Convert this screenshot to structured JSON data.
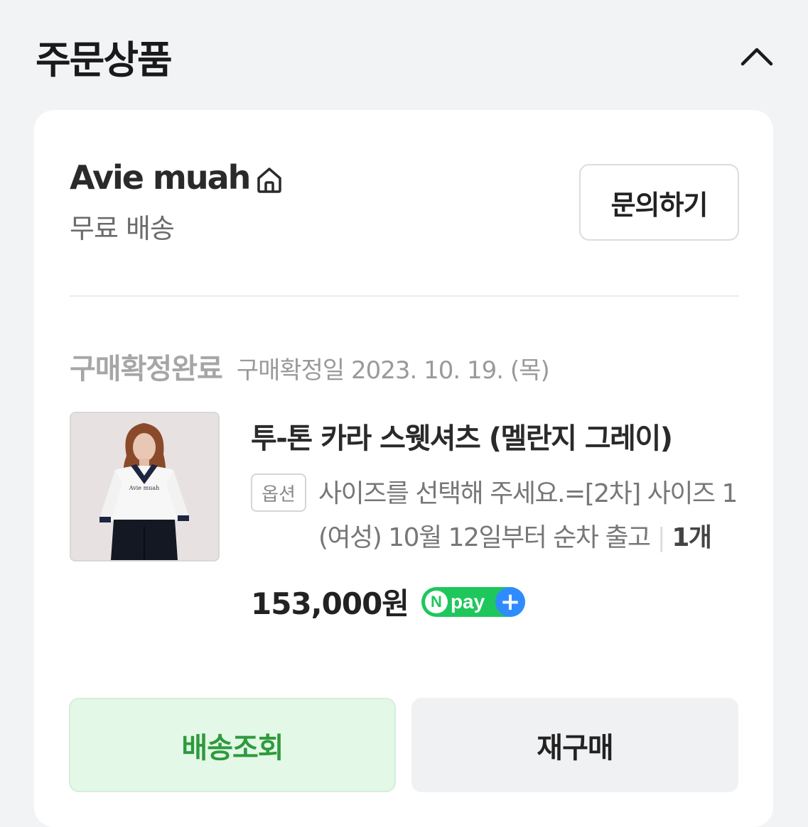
{
  "header": {
    "title": "주문상품",
    "collapse_icon": "chevron-up-icon"
  },
  "seller": {
    "name": "Avie muah",
    "home_icon": "home-icon",
    "shipping": "무료 배송",
    "inquiry_label": "문의하기"
  },
  "order": {
    "status": "구매확정완료",
    "confirm_date": "구매확정일 2023. 10. 19. (목)"
  },
  "product": {
    "name": "투-톤 카라 스웻셔츠 (멜란지 그레이)",
    "option_badge": "옵션",
    "option_text": "사이즈를 선택해 주세요.=[2차] 사이즈 1 (여성) 10월 12일부터 순차 출고",
    "quantity": "1개",
    "price": "153,000원",
    "thumbnail_caption": "Avie muah"
  },
  "npay": {
    "badge_n": "N",
    "badge_text": "pay",
    "badge_plus": "+"
  },
  "actions": {
    "track_label": "배송조회",
    "rebuy_label": "재구매"
  },
  "colors": {
    "npay_green": "#1ec75c",
    "npay_blue": "#2f8cff",
    "track_bg": "#e3f8e6",
    "track_text": "#2e9a3e"
  }
}
